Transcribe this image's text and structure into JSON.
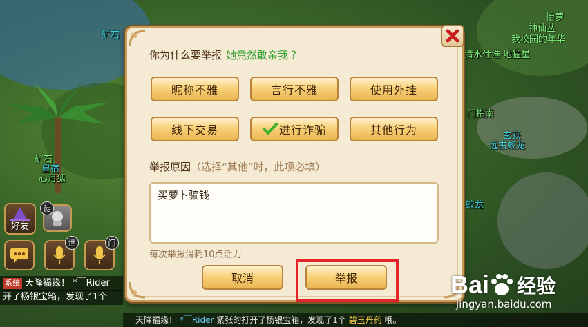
{
  "dialog": {
    "question_prefix": "你为什么要举报",
    "target_name": "她竟然敢亲我",
    "question_mark": "？",
    "reasons": [
      {
        "label": "昵称不雅",
        "selected": false
      },
      {
        "label": "言行不雅",
        "selected": false
      },
      {
        "label": "使用外挂",
        "selected": false
      },
      {
        "label": "线下交易",
        "selected": false
      },
      {
        "label": "进行诈骗",
        "selected": true
      },
      {
        "label": "其他行为",
        "selected": false
      }
    ],
    "reason_label": "举报原因",
    "reason_hint": "（选择“其他”时，此项必填）",
    "reason_text": "买萝卜骗钱",
    "cost_note": "每次举报消耗10点活力",
    "cancel_label": "取消",
    "submit_label": "举报",
    "close_icon": "close-x-icon"
  },
  "hud": {
    "friends_label": "好友",
    "friends_badge": "徒",
    "voice_world_badge": "世",
    "voice_sect_badge": "门",
    "chat_icon": "chat-bubble-icon",
    "mic_icon": "microphone-icon"
  },
  "chat": {
    "line1_tag": "系统",
    "line1_text": "天降福缘！ *￣Rider",
    "line2_text": "开了杨银宝箱，发现了1个",
    "ticker_prefix": "天降福缘！",
    "ticker_player": "*￣Rider",
    "ticker_mid": "紧张的打开了杨银宝箱，发现了1个",
    "ticker_item": "碧玉丹药",
    "ticker_end": "哦。"
  },
  "world_labels": {
    "ore_top": "矿石",
    "ore_left": "矿石",
    "pet_left": "星宿",
    "pet_left_name": "心月狐",
    "right_1": "怡萝",
    "right_2": "神仙丛",
    "right_3": "我校园的年华",
    "right_4": "清水仕淮·地猛星",
    "right_5": "门指南",
    "right_6": "玄跃",
    "right_7": "远古蛟龙",
    "right_8": "蛟龙"
  },
  "watermark": {
    "brand_left": "Bai",
    "brand_right": "经验",
    "url": "jingyan.baidu.com"
  },
  "colors": {
    "dialog_bg": "#f5ead4",
    "button_gold": "#f9d27a",
    "highlight_red": "#e4232b",
    "target_green": "#2f9e2f"
  }
}
